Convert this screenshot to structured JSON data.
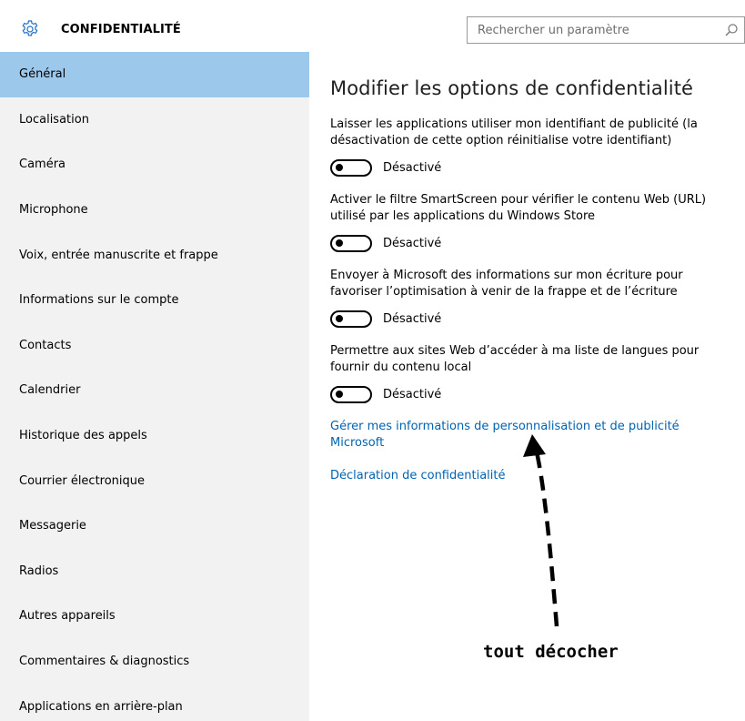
{
  "header": {
    "title": "CONFIDENTIALITÉ",
    "icon": "gear-icon",
    "accent_color": "#1e6fc4"
  },
  "search": {
    "placeholder": "Rechercher un paramètre",
    "icon": "search-icon"
  },
  "sidebar": {
    "active_color": "#9cc8ec",
    "items": [
      {
        "label": "Général"
      },
      {
        "label": "Localisation"
      },
      {
        "label": "Caméra"
      },
      {
        "label": "Microphone"
      },
      {
        "label": "Voix, entrée manuscrite et frappe"
      },
      {
        "label": "Informations sur le compte"
      },
      {
        "label": "Contacts"
      },
      {
        "label": "Calendrier"
      },
      {
        "label": "Historique des appels"
      },
      {
        "label": "Courrier électronique"
      },
      {
        "label": "Messagerie"
      },
      {
        "label": "Radios"
      },
      {
        "label": "Autres appareils"
      },
      {
        "label": "Commentaires & diagnostics"
      },
      {
        "label": "Applications en arrière-plan"
      }
    ]
  },
  "main": {
    "heading": "Modifier les options de confidentialité",
    "settings": [
      {
        "description": "Laisser les applications utiliser mon identifiant de publicité (la désactivation de cette option réinitialise votre identifiant)",
        "state_label": "Désactivé"
      },
      {
        "description": "Activer le filtre SmartScreen pour vérifier le contenu Web (URL) utilisé par les applications du Windows Store",
        "state_label": "Désactivé"
      },
      {
        "description": "Envoyer à Microsoft des informations sur mon écriture pour favoriser l’optimisation à venir de la frappe et de l’écriture",
        "state_label": "Désactivé"
      },
      {
        "description": "Permettre aux sites Web d’accéder à ma liste de langues pour fournir du contenu local",
        "state_label": "Désactivé"
      }
    ],
    "links": [
      {
        "label": "Gérer mes informations de personnalisation et de publicité Microsoft"
      },
      {
        "label": "Déclaration de confidentialité"
      }
    ],
    "link_color": "#0063b1"
  },
  "annotation": {
    "text": "tout décocher"
  }
}
